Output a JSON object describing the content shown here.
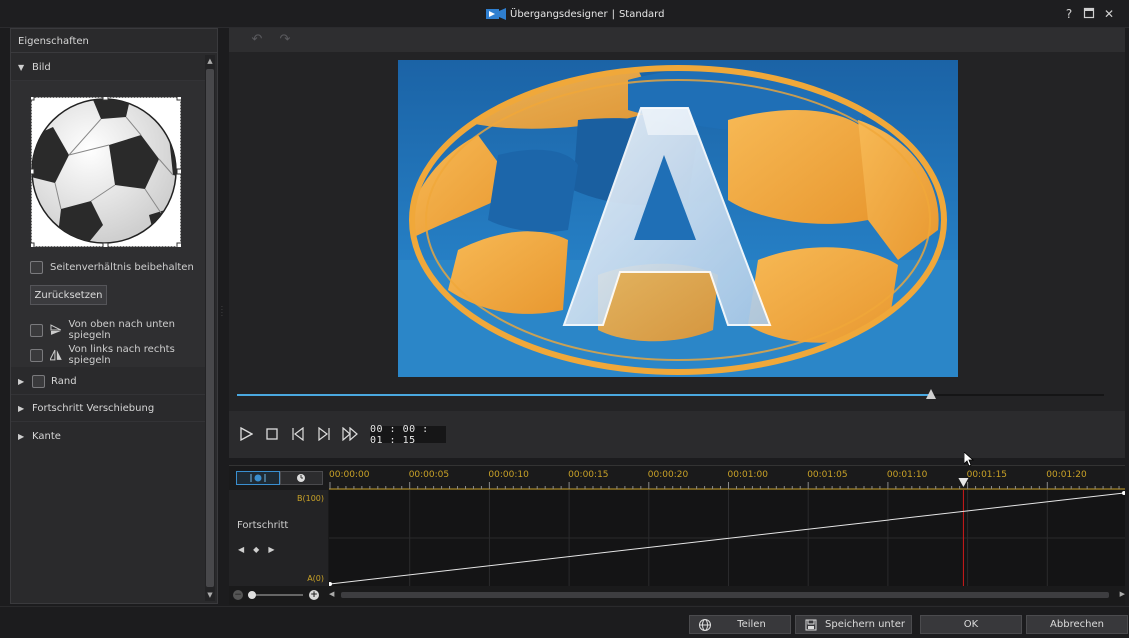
{
  "window": {
    "title": "Übergangsdesigner",
    "separator": "|",
    "subtitle": "Standard",
    "help": "?",
    "close": "✕"
  },
  "properties": {
    "header": "Eigenschaften",
    "sections": {
      "image": "Bild",
      "border": "Rand",
      "progress_shift": "Fortschritt Verschiebung",
      "edge": "Kante"
    },
    "keep_aspect_label": "Seitenverhältnis beibehalten",
    "reset_button": "Zurücksetzen",
    "flip_vertical_label": "Von oben nach unten spiegeln",
    "flip_horizontal_label": "Von links nach rechts spiegeln"
  },
  "player": {
    "progress_fraction": 0.8,
    "timecode": "00 : 00 : 01 : 15",
    "preview_letter": "A"
  },
  "timeline": {
    "labels": [
      "00:00:00",
      "00:00:05",
      "00:00:10",
      "00:00:15",
      "00:00:20",
      "00:01:00",
      "00:01:05",
      "00:01:10",
      "00:01:15",
      "00:01:20"
    ],
    "param_name": "Fortschritt",
    "top_value": "B(100)",
    "bottom_value": "A(0)",
    "playhead_fraction": 0.797
  },
  "footer": {
    "share": "Teilen",
    "save_as": "Speichern unter",
    "ok": "OK",
    "cancel": "Abbrechen"
  },
  "colors": {
    "accent": "#4aa8e0",
    "timeline_label": "#c9a227",
    "playhead": "#d01a1a",
    "preview_blue": "#1d6fb0",
    "preview_orange": "#f0a83a"
  }
}
